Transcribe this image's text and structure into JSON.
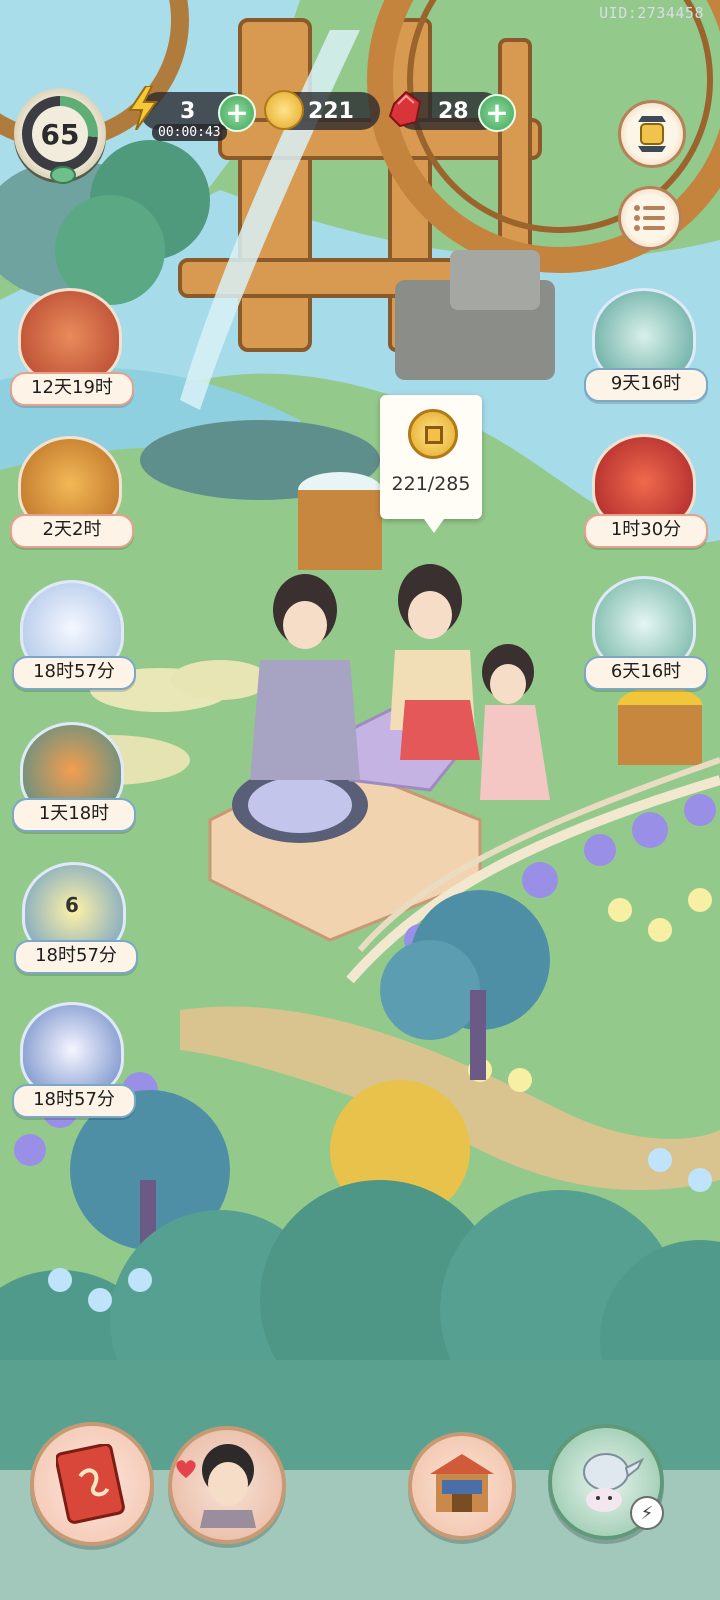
{
  "uid": "UID:2734458",
  "hud": {
    "level": "65",
    "energy": "3",
    "energy_timer": "00:00:43",
    "coins": "221",
    "gems": "28"
  },
  "coin_popup": {
    "text": "221/285"
  },
  "events_left": [
    {
      "timer": "12天19时",
      "icon": "book-scroll-icon"
    },
    {
      "timer": "2天2时",
      "icon": "treasure-chest-icon"
    },
    {
      "timer": "18时57分",
      "icon": "snowman-icon"
    },
    {
      "timer": "1天18时",
      "icon": "maple-festival-icon"
    },
    {
      "timer": "18时57分",
      "icon": "lotus-icon",
      "badge": "6"
    },
    {
      "timer": "18时57分",
      "icon": "lucky-cat-kite-icon"
    }
  ],
  "events_right": [
    {
      "timer": "9天16时",
      "icon": "spirit-beast-icon"
    },
    {
      "timer": "1时30分",
      "icon": "red-gift-box-icon"
    },
    {
      "timer": "6天16时",
      "icon": "cat-gift-icon"
    }
  ],
  "dock": [
    {
      "name": "journal-button",
      "icon": "red-book-icon"
    },
    {
      "name": "character-button",
      "icon": "character-portrait-icon"
    },
    {
      "name": "shop-button",
      "icon": "shop-building-icon"
    },
    {
      "name": "tea-button",
      "icon": "teapot-icon"
    }
  ],
  "colors": {
    "grass": "#8fc48a",
    "water": "#9fd8e8",
    "tag_border": "#e6a08c",
    "plus_green": "#3fa35a"
  }
}
